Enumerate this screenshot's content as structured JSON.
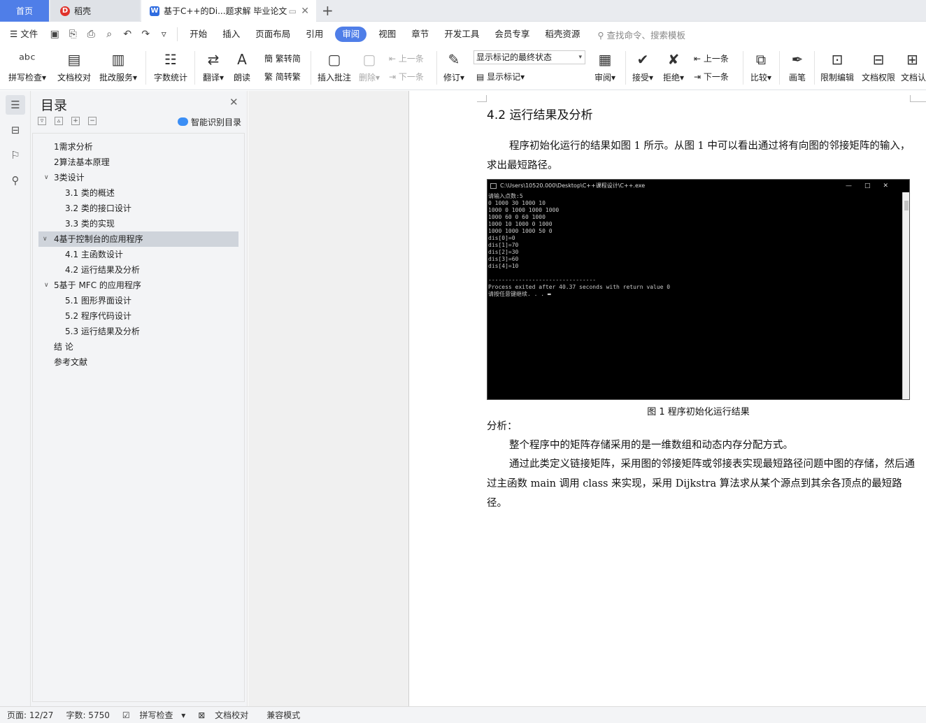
{
  "tabs": {
    "home": "首页",
    "daoke": "稻壳",
    "doc": "基于C++的Di...题求解 毕业论文"
  },
  "menu": {
    "file": "文件",
    "items": [
      "开始",
      "插入",
      "页面布局",
      "引用",
      "审阅",
      "视图",
      "章节",
      "开发工具",
      "会员专享",
      "稻壳资源"
    ],
    "active": "审阅",
    "search": "查找命令、搜索模板"
  },
  "ribbon": {
    "spell": "拼写检查",
    "proof": "文档校对",
    "review_service": "批改服务",
    "word_count": "字数统计",
    "translate": "翻译",
    "read": "朗读",
    "trad_to_simp": "繁转简",
    "simp_to_trad": "简转繁",
    "insert_comment": "插入批注",
    "delete": "删除",
    "prev_comment": "上一条",
    "next_comment": "下一条",
    "revise": "修订",
    "mark_state": "显示标记的最终状态",
    "show_marks": "显示标记",
    "review": "审阅",
    "accept": "接受",
    "reject": "拒绝",
    "prev_change": "上一条",
    "next_change": "下一条",
    "compare": "比较",
    "pen": "画笔",
    "restrict_edit": "限制编辑",
    "doc_permission": "文档权限",
    "doc_auth": "文档认"
  },
  "toc": {
    "title": "目录",
    "smart": "智能识别目录",
    "items": [
      {
        "label": "1需求分析",
        "level": 1
      },
      {
        "label": "2算法基本原理",
        "level": 1
      },
      {
        "label": "3类设计",
        "level": 1
      },
      {
        "label": "3.1  类的概述",
        "level": 2
      },
      {
        "label": "3.2  类的接口设计",
        "level": 2
      },
      {
        "label": "3.3  类的实现",
        "level": 2
      },
      {
        "label": "4基于控制台的应用程序",
        "level": 1
      },
      {
        "label": "4.1  主函数设计",
        "level": 2
      },
      {
        "label": "4.2  运行结果及分析",
        "level": 2
      },
      {
        "label": "5基于 MFC 的应用程序",
        "level": 1
      },
      {
        "label": "5.1  图形界面设计",
        "level": 2
      },
      {
        "label": "5.2  程序代码设计",
        "level": 2
      },
      {
        "label": "5.3  运行结果及分析",
        "level": 2
      },
      {
        "label": "结   论",
        "level": 1
      },
      {
        "label": "参考文献",
        "level": 1
      }
    ]
  },
  "doc": {
    "heading": "4.2  运行结果及分析",
    "para1": "程序初始化运行的结果如图 1 所示。从图 1 中可以看出通过将有向图的邻接矩阵的输入，求出最短路径。",
    "console_title": "C:\\Users\\10520.000\\Desktop\\C++课程设计\\C++.exe",
    "console_lines": "请输入点数:5\n0 1000 30 1000 10\n1000 0 1000 1000 1000\n1000 60 0 60 1000\n1000 10 1000 0 1000\n1000 1000 1000 50 0\ndis[0]=0\ndis[1]=70\ndis[2]=30\ndis[3]=60\ndis[4]=10\n\n--------------------------------\nProcess exited after 40.37 seconds with return value 0\n请按任意键继续. . . ▬",
    "caption": "图 1   程序初始化运行结果",
    "analysis": "分析：",
    "para2": "整个程序中的矩阵存储采用的是一维数组和动态内存分配方式。",
    "para3": "通过此类定义链接矩阵，采用图的邻接矩阵或邻接表实现最短路径问题中图的存储，然后通过主函数 main 调用 class 来实现，采用 Dijkstra 算法求从某个源点到其余各顶点的最短路径。"
  },
  "status": {
    "page": "页面: 12/27",
    "words": "字数: 5750",
    "spell": "拼写检查",
    "proof": "文档校对",
    "compat": "兼容模式"
  }
}
